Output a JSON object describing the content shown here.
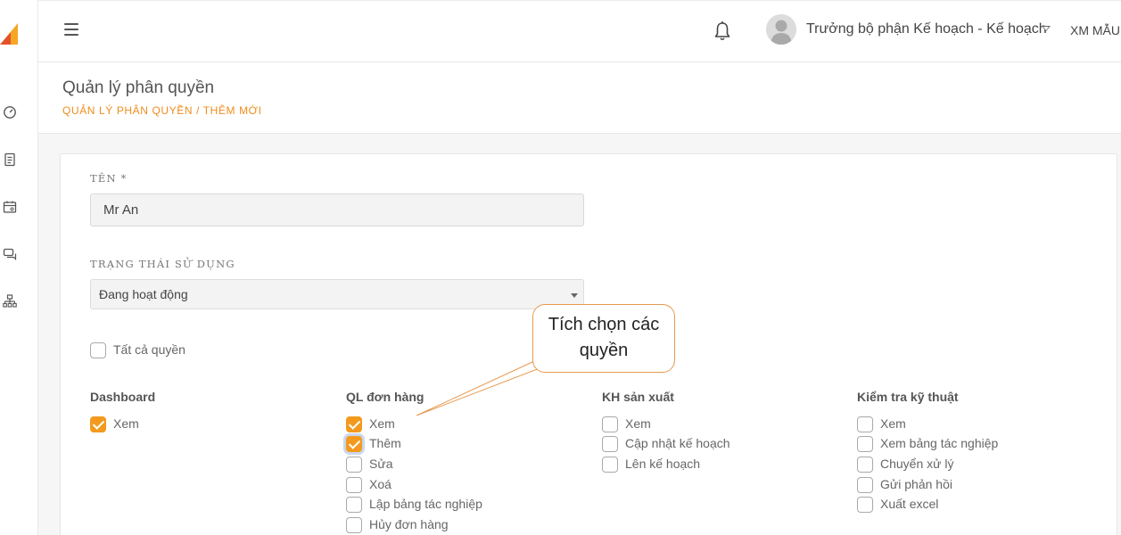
{
  "sidebar": {
    "icons": [
      "dashboard-icon",
      "document-icon",
      "calendar-icon",
      "chat-icon",
      "hierarchy-icon"
    ]
  },
  "header": {
    "user_name": "Trưởng bộ phận Kế hoạch - Kế hoạch",
    "company": "XM MẪU"
  },
  "page": {
    "title": "Quản lý phân quyền",
    "breadcrumb": "QUẢN LÝ PHÂN QUYỀN / THÊM MỚI"
  },
  "form": {
    "name_label": "TÊN *",
    "name_value": "Mr An",
    "status_label": "TRẠNG THÁI SỬ DỤNG",
    "status_value": "Đang hoạt động",
    "all_permissions_label": "Tất cả quyền",
    "all_permissions_checked": false
  },
  "groups": [
    {
      "title": "Dashboard",
      "permissions": [
        {
          "label": "Xem",
          "checked": true
        }
      ]
    },
    {
      "title": "QL đơn hàng",
      "permissions": [
        {
          "label": "Xem",
          "checked": true
        },
        {
          "label": "Thêm",
          "checked": true
        },
        {
          "label": "Sửa",
          "checked": false
        },
        {
          "label": "Xoá",
          "checked": false
        },
        {
          "label": "Lập bảng tác nghiệp",
          "checked": false
        },
        {
          "label": "Hủy đơn hàng",
          "checked": false
        }
      ]
    },
    {
      "title": "KH sản xuất",
      "permissions": [
        {
          "label": "Xem",
          "checked": false
        },
        {
          "label": "Cập nhật kế hoạch",
          "checked": false
        },
        {
          "label": "Lên kế hoạch",
          "checked": false
        }
      ]
    },
    {
      "title": "Kiểm tra kỹ thuật",
      "permissions": [
        {
          "label": "Xem",
          "checked": false
        },
        {
          "label": "Xem bảng tác nghiệp",
          "checked": false
        },
        {
          "label": "Chuyển xử lý",
          "checked": false
        },
        {
          "label": "Gửi phản hồi",
          "checked": false
        },
        {
          "label": "Xuất excel",
          "checked": false
        }
      ]
    }
  ],
  "callout": {
    "line1": "Tích chọn các",
    "line2": "quyền"
  },
  "colors": {
    "accent": "#f39a1e",
    "breadcrumb": "#f08c1c",
    "callout_border": "#e89a4f"
  }
}
